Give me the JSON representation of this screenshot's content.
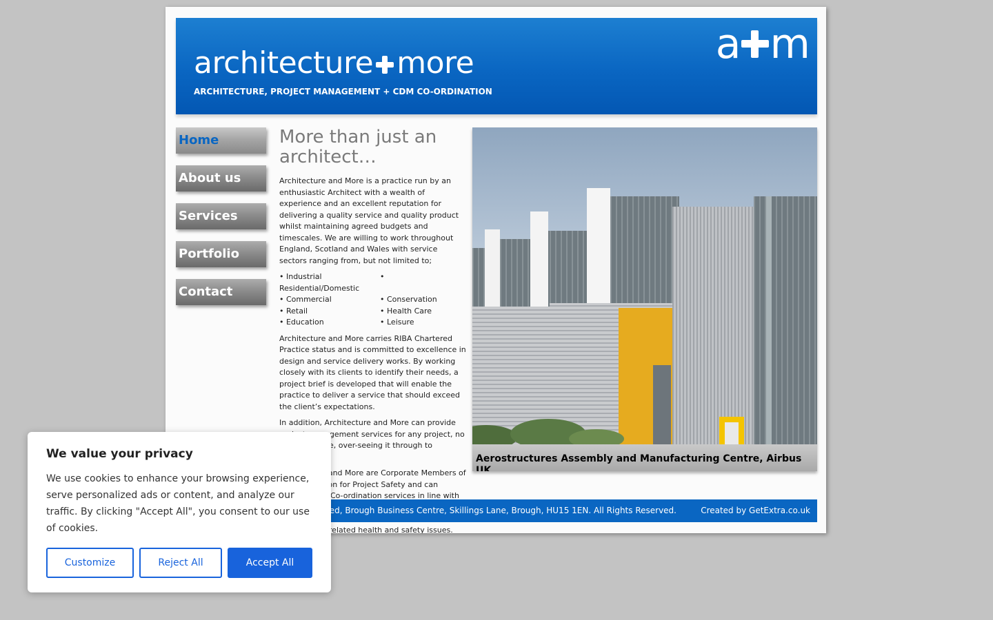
{
  "header": {
    "brand_left": "architecture",
    "brand_right": "more",
    "tagline": "ARCHITECTURE, PROJECT MANAGEMENT + CDM CO-ORDINATION",
    "logo_left": "a",
    "logo_right": "m"
  },
  "nav": {
    "items": [
      {
        "label": "Home"
      },
      {
        "label": "About us"
      },
      {
        "label": "Services"
      },
      {
        "label": "Portfolio"
      },
      {
        "label": "Contact"
      }
    ]
  },
  "content": {
    "heading": "More than just an architect…",
    "intro": "Architecture and More is a practice run by an enthusiastic Architect with a wealth of experience and an excellent reputation for delivering a quality service and quality product whilst maintaining agreed budgets and timescales. We are willing to work throughout England, Scotland and Wales with service sectors ranging from, but not limited to;",
    "sectors": [
      "• Industrial",
      "•",
      "Residential/Domestic",
      "",
      "• Commercial",
      "• Conservation",
      "• Retail",
      "• Health Care",
      "• Education",
      "• Leisure"
    ],
    "para2": "Architecture and More carries RIBA Chartered Practice status and is committed to excellence in design and service delivery works. By working closely with its clients to identify their needs, a project brief is developed that will enable the practice to deliver a service that should exceed the client’s expectations.",
    "para3": "In addition, Architecture and More can provide project management services for any project, no matter its size, over-seeing it through to completion.",
    "para4": "Architecture and More are Corporate Members of the Association for Project Safety and can provide CDM Co-ordination services in line with the Construction (Design and Management) Regulations 2007 and can advise clients on all construction related health and safety issues."
  },
  "photo": {
    "caption": "Aerostructures Assembly and Manufacturing Centre, Airbus UK"
  },
  "footer": {
    "copyright": "ed, Brough Business Centre, Skillings Lane, Brough, HU15 1EN. All Rights Reserved.",
    "credit": "Created by GetExtra.co.uk"
  },
  "cookie": {
    "title": "We value your privacy",
    "text": "We use cookies to enhance your browsing experience, serve personalized ads or content, and analyze our traffic. By clicking \"Accept All\", you consent to our use of cookies.",
    "customize": "Customize",
    "reject": "Reject All",
    "accept": "Accept All"
  },
  "colors": {
    "brand_blue": "#0a66c2",
    "cookie_blue": "#1863dc"
  }
}
